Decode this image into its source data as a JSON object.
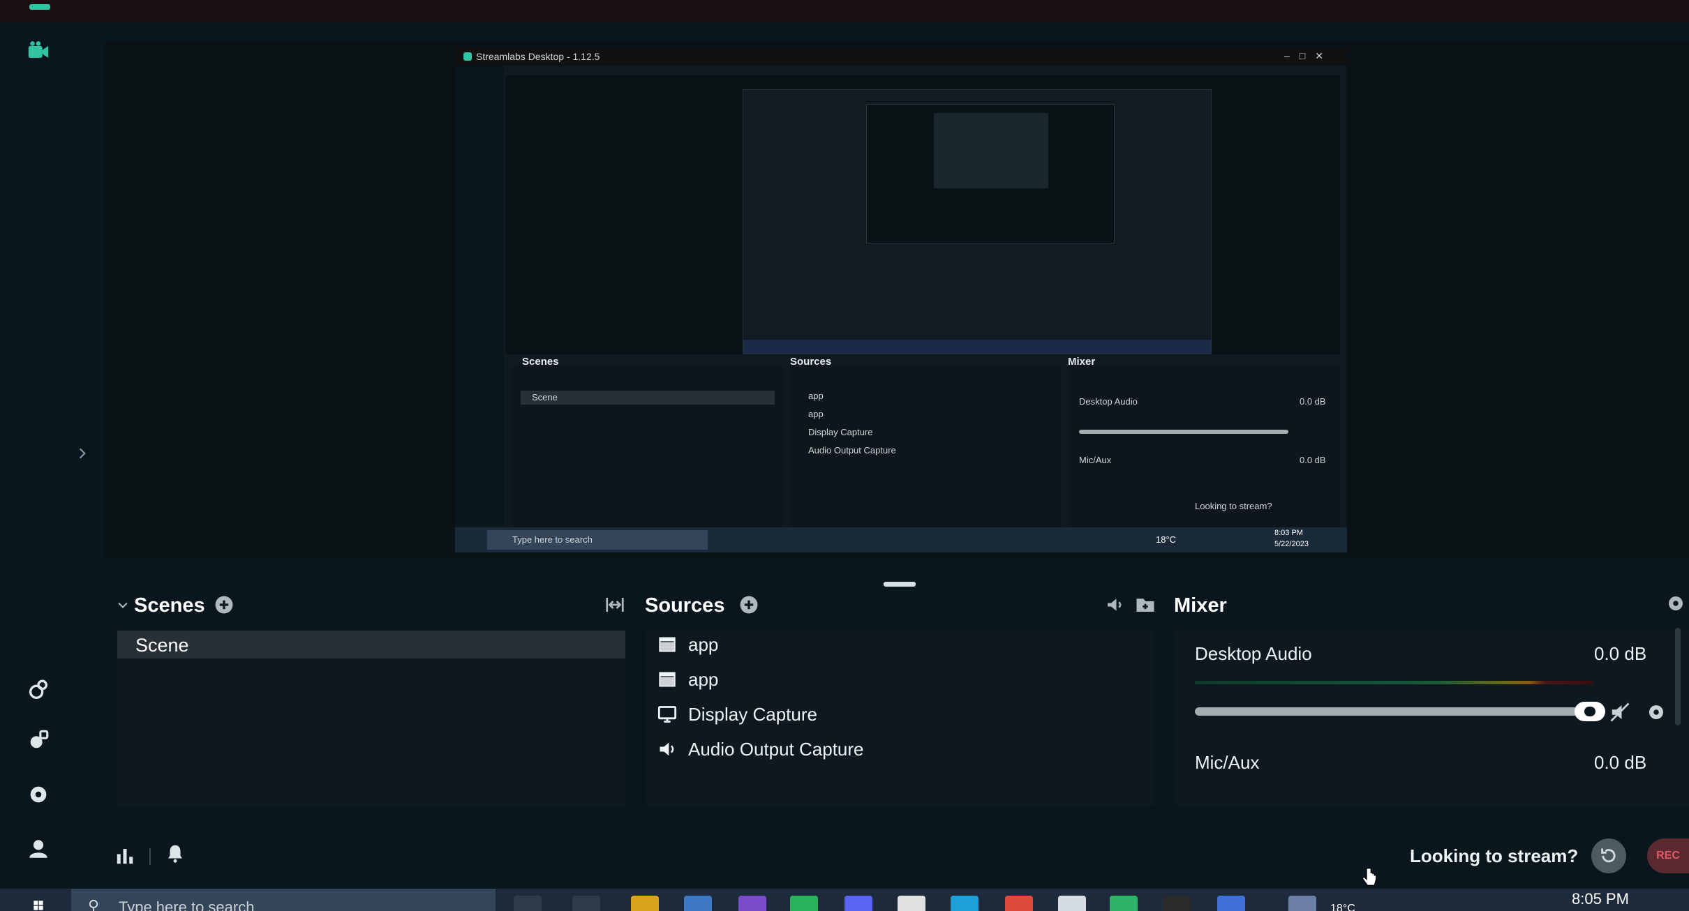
{
  "preview": {
    "window_title": "Streamlabs Desktop - 1.12.5",
    "scenes_header": "Scenes",
    "sources_header": "Sources",
    "mixer_header": "Mixer",
    "scene_item": "Scene",
    "sources": [
      "app",
      "app",
      "Display Capture",
      "Audio Output Capture"
    ],
    "desktop_audio": "Desktop Audio",
    "desktop_audio_db": "0.0 dB",
    "mic_aux": "Mic/Aux",
    "mic_aux_db": "0.0 dB",
    "looking": "Looking to stream?",
    "search_placeholder": "Type here to search",
    "temp": "18°C",
    "time": "8:03 PM",
    "date": "5/22/2023"
  },
  "scenes": {
    "header": "Scenes",
    "items": [
      "Scene"
    ]
  },
  "sources": {
    "header": "Sources",
    "items": [
      {
        "label": "app",
        "icon": "window-icon"
      },
      {
        "label": "app",
        "icon": "window-icon"
      },
      {
        "label": "Display Capture",
        "icon": "monitor-icon"
      },
      {
        "label": "Audio Output Capture",
        "icon": "speaker-icon"
      }
    ]
  },
  "mixer": {
    "header": "Mixer",
    "channels": [
      {
        "name": "Desktop Audio",
        "db": "0.0 dB"
      },
      {
        "name": "Mic/Aux",
        "db": "0.0 dB"
      }
    ]
  },
  "footer": {
    "looking": "Looking to stream?",
    "rec_label": "REC"
  },
  "taskbar": {
    "search_placeholder": "Type here to search",
    "temp": "18°C",
    "time": "8:05 PM"
  },
  "colors": {
    "accent": "#31c3a2",
    "background": "#09161d",
    "panel": "#0d181f",
    "rec": "#e45a64"
  }
}
